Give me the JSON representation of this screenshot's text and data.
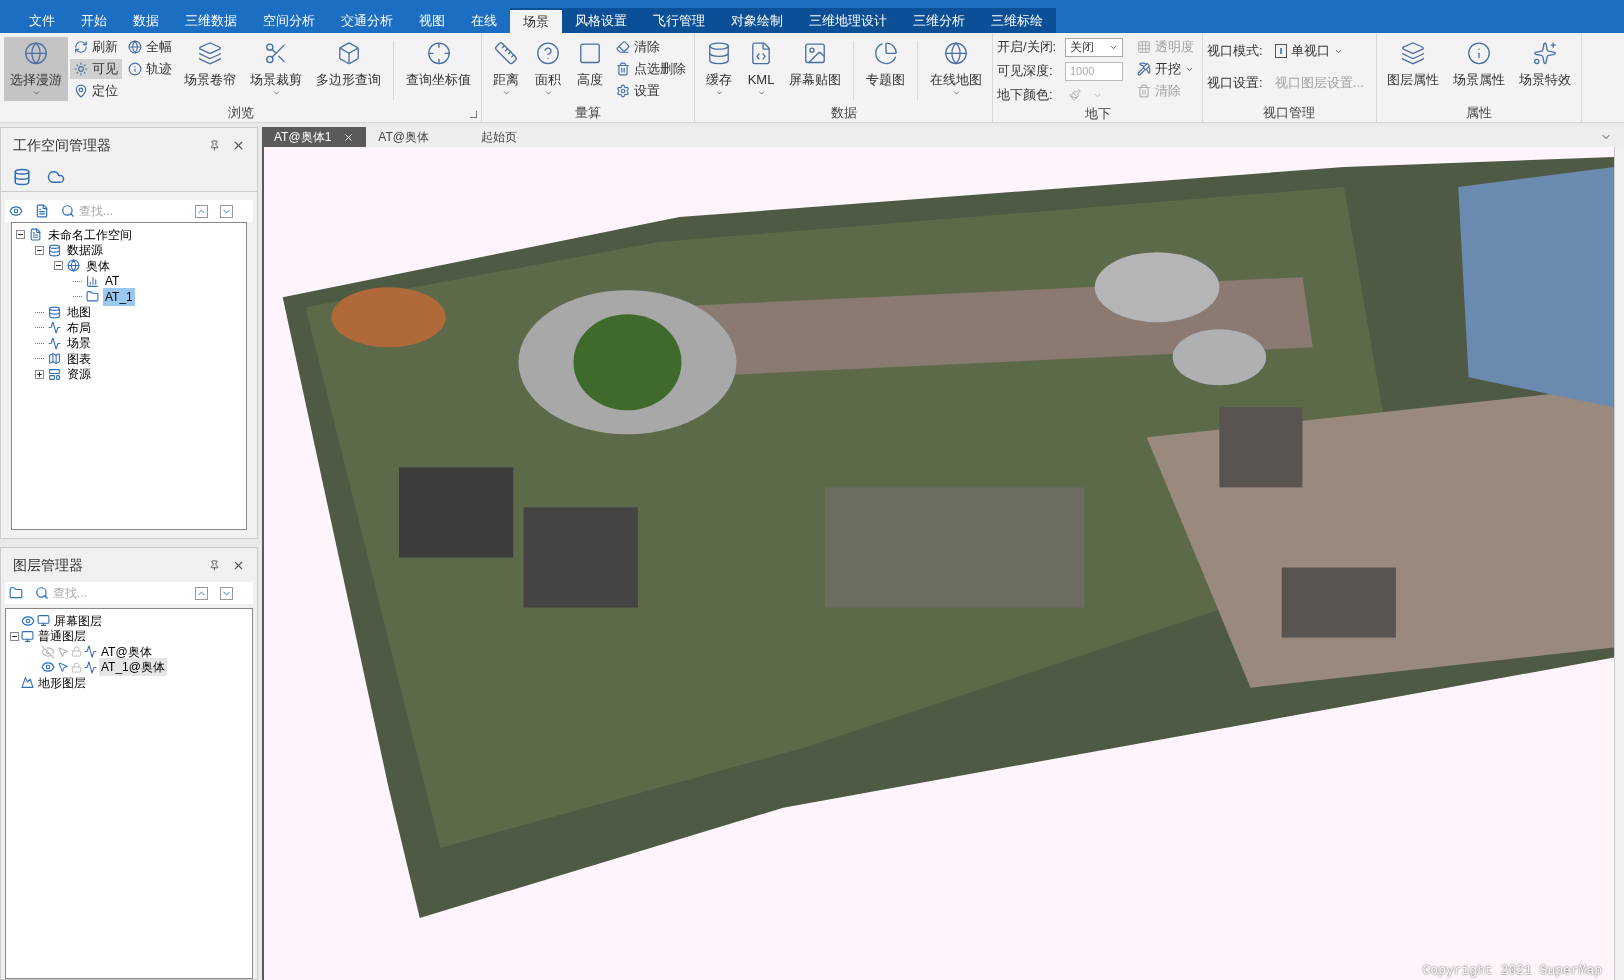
{
  "menu_tabs": [
    {
      "label": "文件",
      "selected": false,
      "contextual": false
    },
    {
      "label": "开始",
      "selected": false,
      "contextual": false
    },
    {
      "label": "数据",
      "selected": false,
      "contextual": false
    },
    {
      "label": "三维数据",
      "selected": false,
      "contextual": false
    },
    {
      "label": "空间分析",
      "selected": false,
      "contextual": false
    },
    {
      "label": "交通分析",
      "selected": false,
      "contextual": false
    },
    {
      "label": "视图",
      "selected": false,
      "contextual": false
    },
    {
      "label": "在线",
      "selected": false,
      "contextual": false
    },
    {
      "label": "场景",
      "selected": true,
      "contextual": true
    },
    {
      "label": "风格设置",
      "selected": false,
      "contextual": true
    },
    {
      "label": "飞行管理",
      "selected": false,
      "contextual": true
    },
    {
      "label": "对象绘制",
      "selected": false,
      "contextual": true
    },
    {
      "label": "三维地理设计",
      "selected": false,
      "contextual": true
    },
    {
      "label": "三维分析",
      "selected": false,
      "contextual": true
    },
    {
      "label": "三维标绘",
      "selected": false,
      "contextual": true
    }
  ],
  "ribbon_groups": [
    {
      "label": "浏览",
      "launcher": true,
      "items": [
        {
          "kind": "large",
          "label": "选择漫游",
          "selected": true,
          "dropdown": true
        },
        {
          "kind": "stack",
          "items": [
            {
              "label": "刷新",
              "selected": false,
              "disabled": false
            },
            {
              "label": "可见",
              "selected": true,
              "disabled": false
            },
            {
              "label": "定位",
              "selected": false,
              "disabled": false
            }
          ]
        },
        {
          "kind": "stack",
          "items": [
            {
              "label": "全幅",
              "selected": false,
              "disabled": false
            },
            {
              "label": "轨迹",
              "selected": false,
              "disabled": false
            }
          ]
        },
        {
          "kind": "large",
          "label": "场景卷帘",
          "selected": false,
          "dropdown": false
        },
        {
          "kind": "large",
          "label": "场景裁剪",
          "selected": false,
          "dropdown": true
        },
        {
          "kind": "large",
          "label": "多边形查询",
          "selected": false,
          "dropdown": false
        },
        {
          "kind": "separator"
        },
        {
          "kind": "large",
          "label": "查询坐标值",
          "selected": false,
          "dropdown": false
        }
      ]
    },
    {
      "label": "量算",
      "items": [
        {
          "kind": "large",
          "label": "距离",
          "selected": false,
          "dropdown": true
        },
        {
          "kind": "large",
          "label": "面积",
          "selected": false,
          "dropdown": true
        },
        {
          "kind": "large",
          "label": "高度",
          "selected": false,
          "dropdown": false
        },
        {
          "kind": "stack",
          "items": [
            {
              "label": "清除",
              "selected": false,
              "disabled": false
            },
            {
              "label": "点选删除",
              "selected": false,
              "disabled": false
            },
            {
              "label": "设置",
              "selected": false,
              "disabled": false
            }
          ]
        }
      ]
    },
    {
      "label": "数据",
      "items": [
        {
          "kind": "large",
          "label": "缓存",
          "selected": false,
          "dropdown": true
        },
        {
          "kind": "large",
          "label": "KML",
          "selected": false,
          "dropdown": true
        },
        {
          "kind": "large",
          "label": "屏幕贴图",
          "selected": false,
          "dropdown": false
        },
        {
          "kind": "separator"
        },
        {
          "kind": "large",
          "label": "专题图",
          "selected": false,
          "dropdown": false
        },
        {
          "kind": "separator"
        },
        {
          "kind": "large",
          "label": "在线地图",
          "selected": false,
          "dropdown": true
        }
      ]
    },
    {
      "label": "地下",
      "items": [
        {
          "kind": "form",
          "rows": [
            {
              "label": "开启/关闭:",
              "kind": "select",
              "value": "关闭",
              "disabled": false
            },
            {
              "label": "可见深度:",
              "kind": "input",
              "value": "1000",
              "disabled": true
            },
            {
              "label": "地下颜色:",
              "kind": "color",
              "disabled": true
            }
          ]
        },
        {
          "kind": "stack",
          "items": [
            {
              "label": "透明度",
              "selected": false,
              "disabled": true
            },
            {
              "label": "开挖",
              "selected": false,
              "disabled": false,
              "dropdown": true
            },
            {
              "label": "清除",
              "selected": false,
              "disabled": true
            }
          ]
        }
      ]
    },
    {
      "label": "视口管理",
      "items": [
        {
          "kind": "form",
          "rows": [
            {
              "label": "视口模式:",
              "kind": "menu",
              "value": "单视口",
              "disabled": false
            },
            {
              "label": "视口设置:",
              "kind": "link",
              "value": "视口图层设置...",
              "disabled": true
            }
          ]
        }
      ]
    },
    {
      "label": "属性",
      "items": [
        {
          "kind": "large",
          "label": "图层属性",
          "selected": false,
          "dropdown": false
        },
        {
          "kind": "large",
          "label": "场景属性",
          "selected": false,
          "dropdown": false
        },
        {
          "kind": "large",
          "label": "场景特效",
          "selected": false,
          "dropdown": false
        }
      ]
    }
  ],
  "workspace_manager": {
    "title": "工作空间管理器",
    "search": {
      "placeholder": "查找..."
    },
    "tree": [
      {
        "label": "未命名工作空间",
        "selected": false,
        "expanded": true,
        "children": [
          {
            "label": "数据源",
            "selected": false,
            "expanded": true,
            "children": [
              {
                "label": "奥体",
                "selected": false,
                "expanded": true,
                "children": [
                  {
                    "label": "AT",
                    "selected": false
                  },
                  {
                    "label": "AT_1",
                    "selected": true
                  }
                ]
              }
            ]
          },
          {
            "label": "地图",
            "selected": false
          },
          {
            "label": "布局",
            "selected": false
          },
          {
            "label": "场景",
            "selected": false
          },
          {
            "label": "图表",
            "selected": false
          },
          {
            "label": "资源",
            "selected": false,
            "expanded": false
          }
        ]
      }
    ]
  },
  "layer_manager": {
    "title": "图层管理器",
    "search": {
      "placeholder": "查找..."
    },
    "tree": [
      {
        "label": "屏幕图层",
        "kind": "group",
        "visible": true
      },
      {
        "label": "普通图层",
        "kind": "group",
        "expanded": true,
        "children": [
          {
            "label": "AT@奥体",
            "kind": "layer",
            "visible": false,
            "selectable": false,
            "selected": false
          },
          {
            "label": "AT_1@奥体",
            "kind": "layer",
            "visible": true,
            "selectable": true,
            "selected": true
          }
        ]
      },
      {
        "label": "地形图层",
        "kind": "terrain"
      }
    ]
  },
  "doc_tabs": [
    {
      "label": "AT@奥体1",
      "selected": true
    },
    {
      "label": "AT@奥体",
      "selected": false
    },
    {
      "label": "起始页",
      "selected": false
    }
  ],
  "scene": {
    "kind": "picture",
    "copyright": "Copyright 2021 SuperMap"
  }
}
